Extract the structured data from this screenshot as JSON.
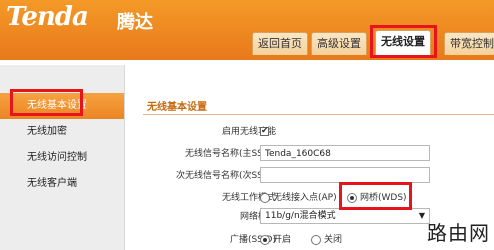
{
  "brand": {
    "logo": "Tenda",
    "logo_cn": "腾达"
  },
  "tabs": [
    {
      "label": "返回首页"
    },
    {
      "label": "高级设置"
    },
    {
      "label": "无线设置"
    },
    {
      "label": "带宽控制"
    }
  ],
  "sidebar": {
    "items": [
      {
        "label": "无线基本设置"
      },
      {
        "label": "无线加密"
      },
      {
        "label": "无线访问控制"
      },
      {
        "label": "无线客户端"
      }
    ]
  },
  "form": {
    "title": "无线基本设置",
    "enable_label": "启用无线功能",
    "enable_value": "✔",
    "ssid_label": "无线信号名称(主SSID)",
    "ssid_value": "Tenda_160C68",
    "ssid2_label": "次无线信号名称(次SSID)",
    "ssid2_value": "",
    "mode_label": "无线工作模式",
    "mode_option_ap": "无线接入点(AP)",
    "mode_option_wds": "网桥(WDS)",
    "net_mode_label": "网络模式",
    "net_mode_value": "11b/g/n混合模式",
    "broadcast_label": "广播(SSID)",
    "broadcast_on": "开启",
    "broadcast_off": "关闭"
  },
  "watermark": "路由网",
  "colors": {
    "header": "#f08a22",
    "highlight": "#e8141b",
    "accent_text": "#c86a10"
  }
}
